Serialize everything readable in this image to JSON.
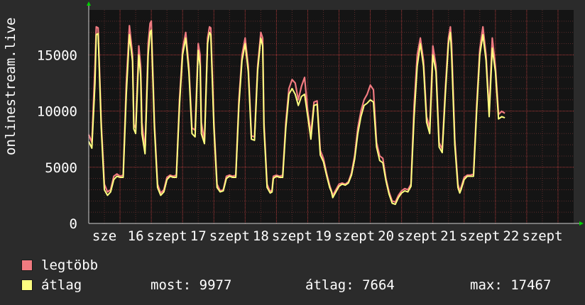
{
  "chart_data": {
    "type": "area",
    "ylabel": "onlinestream.live",
    "yticks": [
      0,
      5000,
      10000,
      15000
    ],
    "ylim": [
      0,
      19000
    ],
    "xlim": [
      0,
      7.75
    ],
    "grid": true,
    "xtick_labels": [
      {
        "label": "sze",
        "x": 0.25
      },
      {
        "label": "16",
        "x": 0.75
      },
      {
        "label": "szept",
        "x": 1.25
      },
      {
        "label": "17",
        "x": 1.75
      },
      {
        "label": "szept",
        "x": 2.25
      },
      {
        "label": "18",
        "x": 2.75
      },
      {
        "label": "szept",
        "x": 3.25
      },
      {
        "label": "19",
        "x": 3.75
      },
      {
        "label": "szept",
        "x": 4.25
      },
      {
        "label": "20",
        "x": 4.75
      },
      {
        "label": "szept",
        "x": 5.25
      },
      {
        "label": "21",
        "x": 5.75
      },
      {
        "label": "szept",
        "x": 6.25
      },
      {
        "label": "22",
        "x": 6.75
      },
      {
        "label": "szept",
        "x": 7.25
      }
    ],
    "x": [
      0.0,
      0.05,
      0.1,
      0.12,
      0.15,
      0.2,
      0.25,
      0.3,
      0.35,
      0.4,
      0.45,
      0.5,
      0.55,
      0.6,
      0.65,
      0.7,
      0.72,
      0.75,
      0.8,
      0.83,
      0.85,
      0.9,
      0.95,
      0.98,
      1.0,
      1.05,
      1.1,
      1.15,
      1.2,
      1.25,
      1.3,
      1.35,
      1.4,
      1.45,
      1.5,
      1.55,
      1.6,
      1.65,
      1.7,
      1.75,
      1.78,
      1.8,
      1.85,
      1.9,
      1.93,
      1.95,
      2.0,
      2.05,
      2.1,
      2.15,
      2.2,
      2.25,
      2.3,
      2.35,
      2.4,
      2.45,
      2.5,
      2.55,
      2.6,
      2.65,
      2.7,
      2.75,
      2.78,
      2.8,
      2.85,
      2.9,
      2.93,
      2.95,
      3.0,
      3.05,
      3.1,
      3.15,
      3.2,
      3.25,
      3.3,
      3.35,
      3.4,
      3.45,
      3.5,
      3.55,
      3.6,
      3.65,
      3.7,
      3.75,
      3.8,
      3.85,
      3.88,
      3.9,
      3.95,
      4.0,
      4.05,
      4.1,
      4.15,
      4.2,
      4.25,
      4.3,
      4.35,
      4.4,
      4.45,
      4.5,
      4.55,
      4.6,
      4.65,
      4.7,
      4.75,
      4.8,
      4.85,
      4.9,
      4.95,
      5.0,
      5.05,
      5.1,
      5.15,
      5.2,
      5.25,
      5.3,
      5.35,
      5.4,
      5.45,
      5.5,
      5.55,
      5.6,
      5.65,
      5.7,
      5.75,
      5.78,
      5.8,
      5.85,
      5.9,
      5.93,
      5.95,
      6.0,
      6.05,
      6.1,
      6.15,
      6.2,
      6.25,
      6.3,
      6.35,
      6.4,
      6.45,
      6.5,
      6.55,
      6.6,
      6.65,
      6.7,
      6.75,
      6.78,
      6.8,
      6.85,
      6.9,
      6.93,
      6.95,
      7.0
    ],
    "series": [
      {
        "name": "legtöbb",
        "color": "#f07a80",
        "values": [
          7900,
          7200,
          14000,
          17500,
          17400,
          9000,
          3500,
          2800,
          3000,
          4200,
          4400,
          4200,
          4300,
          12500,
          17600,
          15000,
          8800,
          8500,
          15800,
          14000,
          9000,
          6500,
          16000,
          17800,
          18000,
          9000,
          3500,
          2700,
          3000,
          4100,
          4300,
          4200,
          4300,
          11000,
          15500,
          17000,
          14000,
          8500,
          8300,
          16000,
          15000,
          9000,
          7300,
          16500,
          17500,
          17400,
          9000,
          3500,
          2900,
          3000,
          4200,
          4300,
          4200,
          4300,
          11000,
          15000,
          16500,
          14000,
          7800,
          7700,
          14000,
          17000,
          16500,
          9000,
          3500,
          2800,
          3000,
          4200,
          4300,
          4200,
          4300,
          9000,
          12000,
          12800,
          12500,
          11000,
          12200,
          13000,
          10000,
          8000,
          10800,
          10900,
          6500,
          5800,
          4500,
          3400,
          2900,
          2500,
          3000,
          3500,
          3600,
          3500,
          3700,
          4500,
          6000,
          8500,
          10000,
          11000,
          11500,
          12300,
          11900,
          7200,
          6000,
          5800,
          4000,
          2800,
          2000,
          1900,
          2500,
          2900,
          3100,
          3000,
          3500,
          10500,
          15000,
          16500,
          14500,
          9500,
          8500,
          15800,
          14000,
          7200,
          6600,
          12000,
          16500,
          17500,
          16000,
          7500,
          3500,
          2900,
          3200,
          4100,
          4300,
          4300,
          4400,
          10500,
          15500,
          17500,
          15000,
          10000,
          16500,
          14000,
          9700,
          9977,
          9800
        ]
      },
      {
        "name": "átlag",
        "color": "#ffff80",
        "values": [
          7300,
          6700,
          12500,
          16800,
          16900,
          8500,
          3000,
          2500,
          2800,
          3900,
          4200,
          4100,
          4100,
          11500,
          16800,
          14400,
          8400,
          8000,
          15000,
          13200,
          8000,
          6200,
          15000,
          17000,
          17200,
          8500,
          3200,
          2500,
          2800,
          3900,
          4200,
          4100,
          4100,
          10500,
          15000,
          16500,
          13500,
          8000,
          7700,
          15400,
          14000,
          8000,
          7100,
          16000,
          17000,
          16800,
          8500,
          3200,
          2800,
          2900,
          4000,
          4200,
          4100,
          4100,
          10500,
          14500,
          16000,
          13500,
          7500,
          7400,
          13600,
          16500,
          15800,
          8500,
          3200,
          2700,
          2800,
          4000,
          4200,
          4100,
          4100,
          8500,
          11500,
          12000,
          11500,
          10500,
          11300,
          11500,
          9500,
          7500,
          10500,
          10600,
          6100,
          5500,
          4300,
          3200,
          2800,
          2300,
          2800,
          3300,
          3500,
          3400,
          3600,
          4300,
          5700,
          8000,
          9500,
          10500,
          10700,
          11000,
          10800,
          6800,
          5600,
          5400,
          3800,
          2600,
          1800,
          1700,
          2300,
          2700,
          2900,
          2800,
          3300,
          9500,
          14000,
          16000,
          14000,
          9000,
          8000,
          15000,
          13500,
          6800,
          6300,
          11500,
          16000,
          17000,
          15000,
          7000,
          3200,
          2700,
          3000,
          3900,
          4200,
          4200,
          4200,
          10000,
          15000,
          16800,
          14500,
          9500,
          15600,
          13500,
          9300,
          9500,
          9400
        ]
      }
    ]
  },
  "legend": {
    "max_label": "legtöbb",
    "avg_label": "átlag",
    "max_color": "#f07a80",
    "avg_color": "#ffff80"
  },
  "stats": {
    "now": "most: 9977",
    "avg": "átlag: 7664",
    "max": "max: 17467"
  },
  "colors": {
    "background": "#2b2b2b",
    "plot_background": "#141414",
    "grid_minor": "#5a2b2b",
    "axis_arrow": "#00d000",
    "text": "#ffffff"
  }
}
